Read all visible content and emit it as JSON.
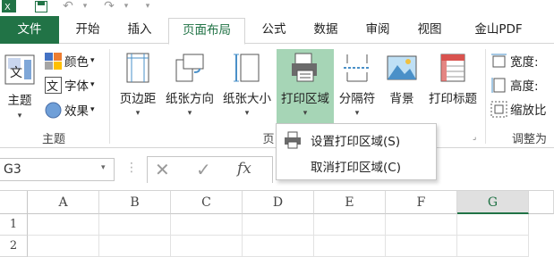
{
  "tabs": [
    "文件",
    "开始",
    "插入",
    "页面布局",
    "公式",
    "数据",
    "审阅",
    "视图",
    "金山PDF"
  ],
  "ribbon": {
    "themes": {
      "big_label": "主题",
      "colors_label": "颜色",
      "fonts_label": "字体",
      "effects_label": "效果",
      "group_label": "主题"
    },
    "page_setup": {
      "margins_label": "页边距",
      "orientation_label": "纸张方向",
      "size_label": "纸张大小",
      "print_area_label": "打印区域",
      "breaks_label": "分隔符",
      "background_label": "背景",
      "print_titles_label": "打印标题",
      "group_label_partial": "页"
    },
    "scale": {
      "width_label": "宽度:",
      "height_label": "高度:",
      "scale_label": "缩放比",
      "group_label": "调整为"
    }
  },
  "print_area_menu": {
    "items": [
      {
        "label": "设置打印区域(S)"
      },
      {
        "label": "取消打印区域(C)"
      }
    ]
  },
  "formula_bar": {
    "name_box": "G3",
    "fx": "fx"
  },
  "grid": {
    "columns": [
      "A",
      "B",
      "C",
      "D",
      "E",
      "F",
      "G"
    ],
    "rows": [
      "1",
      "2"
    ],
    "selected_column": "G"
  },
  "colors": {
    "accent": "#217346",
    "highlight": "#a6d5b6"
  }
}
